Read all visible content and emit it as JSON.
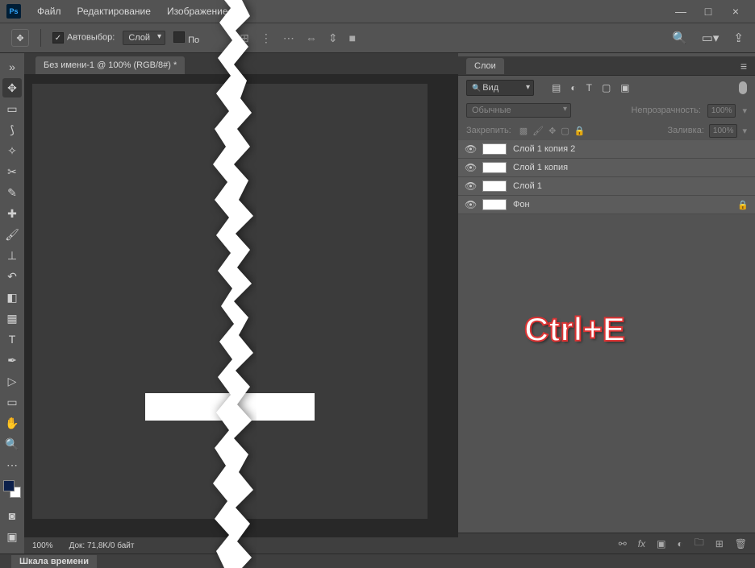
{
  "menu": {
    "file": "Файл",
    "edit": "Редактирование",
    "image": "Изображение"
  },
  "window": {
    "min": "—",
    "max": "□",
    "close": "×"
  },
  "options": {
    "auto_select": "Автовыбор:",
    "layer_drop": "Слой",
    "show_ctrl": "По"
  },
  "doc": {
    "tab": "Без имени-1 @ 100% (RGB/8#) *",
    "zoom": "100%",
    "docinfo": "Док: 71,8K/0 байт"
  },
  "panels": {
    "layers_title": "Слои",
    "filter_kind": "Вид",
    "blend_mode": "Обычные",
    "opacity_label": "Непрозрачность:",
    "opacity_val": "100%",
    "lock_label": "Закрепить:",
    "fill_label": "Заливка:",
    "fill_val": "100%"
  },
  "layers": [
    {
      "name": "Слой 1 копия 2",
      "locked": false
    },
    {
      "name": "Слой 1 копия",
      "locked": false
    },
    {
      "name": "Слой 1",
      "locked": false
    },
    {
      "name": "Фон",
      "locked": true
    }
  ],
  "timeline": {
    "title": "Шкала времени"
  },
  "annotation": "Ctrl+E"
}
